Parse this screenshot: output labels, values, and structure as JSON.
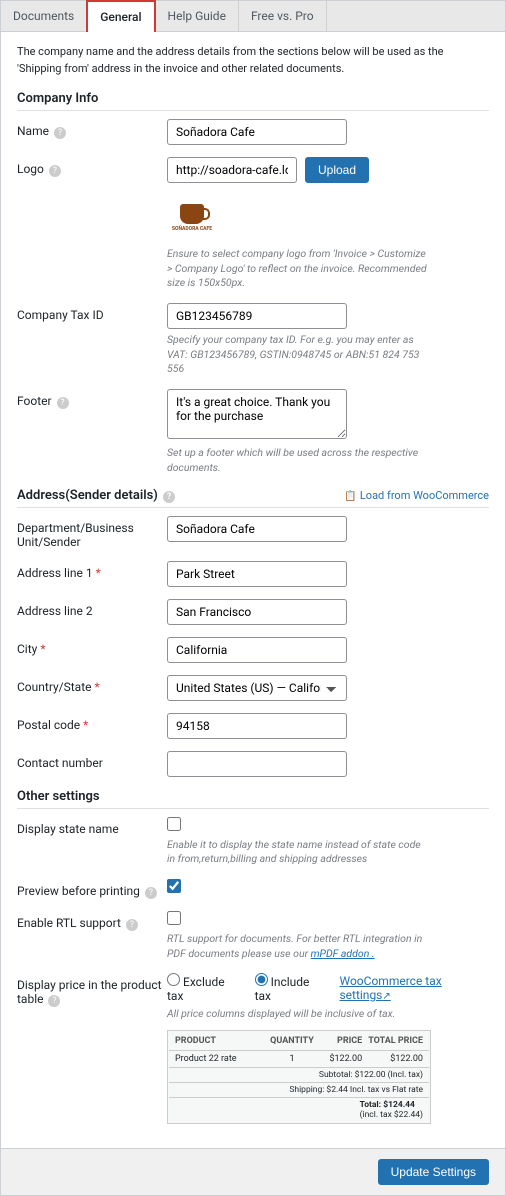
{
  "tabs": [
    {
      "label": "Documents"
    },
    {
      "label": "General"
    },
    {
      "label": "Help Guide"
    },
    {
      "label": "Free vs. Pro"
    }
  ],
  "intro": "The company name and the address details from the sections below will be used as the 'Shipping from' address in the invoice and other related documents.",
  "s1": {
    "title": "Company Info"
  },
  "name": {
    "label": "Name",
    "value": "Soñadora Cafe"
  },
  "logo": {
    "label": "Logo",
    "value": "http://soadora-cafe.local/wp",
    "btn": "Upload",
    "brand": "SOÑADORA CAFE",
    "hint": "Ensure to select company logo from 'Invoice > Customize > Company Logo' to reflect on the invoice. Recommended size is 150x50px."
  },
  "tax": {
    "label": "Company Tax ID",
    "value": "GB123456789",
    "hint": "Specify your company tax ID. For e.g. you may enter as VAT: GB123456789, GSTIN:0948745 or ABN:51 824 753 556"
  },
  "footer": {
    "label": "Footer",
    "value": "It's a great choice. Thank you for the purchase",
    "hint": "Set up a footer which will be used across the respective documents."
  },
  "s2": {
    "title": "Address(Sender details)",
    "link": "Load from WooCommerce"
  },
  "dept": {
    "label": "Department/Business Unit/Sender",
    "value": "Soñadora Cafe"
  },
  "a1": {
    "label": "Address line 1",
    "value": "Park Street"
  },
  "a2": {
    "label": "Address line 2",
    "value": "San Francisco"
  },
  "city": {
    "label": "City",
    "value": "California"
  },
  "country": {
    "label": "Country/State",
    "value": "United States (US) — California"
  },
  "postal": {
    "label": "Postal code",
    "value": "94158"
  },
  "contact": {
    "label": "Contact number",
    "value": ""
  },
  "s3": {
    "title": "Other settings"
  },
  "state": {
    "label": "Display state name",
    "hint": "Enable it to display the state name instead of state code in from,return,billing and shipping addresses"
  },
  "preview": {
    "label": "Preview before printing"
  },
  "rtl": {
    "label": "Enable RTL support",
    "hint": "RTL support for documents. For better RTL integration in PDF documents please use our ",
    "hintlink": "mPDF addon ."
  },
  "price": {
    "label": "Display price in the product table",
    "excl": "Exclude tax",
    "incl": "Include tax",
    "link": "WooCommerce tax settings",
    "hint": "All price columns displayed will be inclusive of tax."
  },
  "tbl": {
    "h1": "PRODUCT",
    "h2": "QUANTITY",
    "h3": "PRICE",
    "h4": "TOTAL PRICE",
    "p": "Product 22 rate",
    "q": "1",
    "pr": "$122.00",
    "tp": "$122.00",
    "sub_l": "Subtotal:",
    "sub_v": "$122.00 (Incl. tax)",
    "ship_l": "Shipping:",
    "ship_v": "$2.44 Incl. tax vs Flat rate",
    "tot_l": "Total:",
    "tot_v": "$124.44",
    "tot_v2": "(incl. tax $22.44)"
  },
  "save": "Update Settings"
}
